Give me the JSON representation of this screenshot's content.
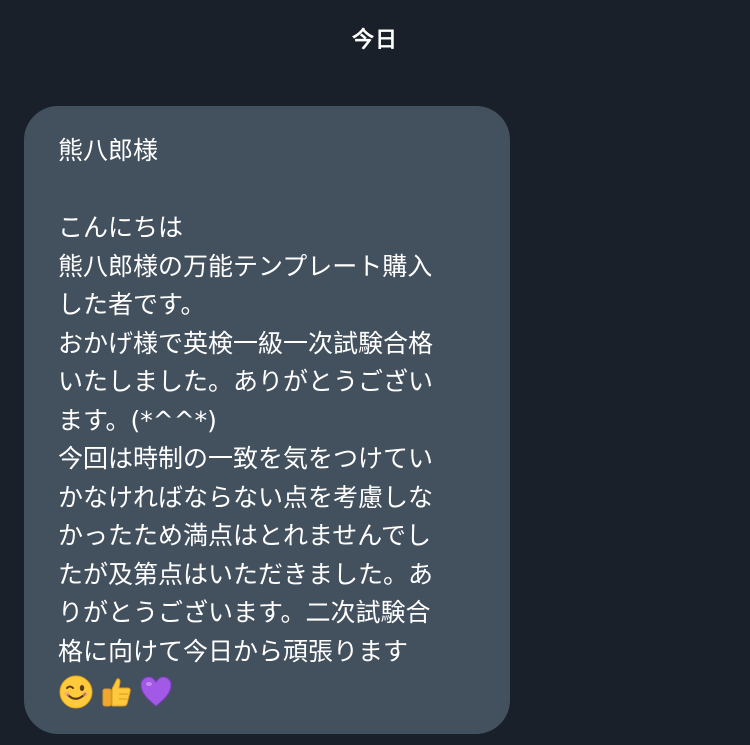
{
  "date_divider": "今日",
  "message": {
    "salutation": "熊八郎様",
    "lines": [
      "こんにちは",
      "熊八郎様の万能テンプレート購入",
      "した者です。",
      "おかげ様で英検一級一次試験合格",
      "いたしました。ありがとうござい",
      "ます。(*^^*)",
      "今回は時制の一致を気をつけてい",
      "かなければならない点を考慮しな",
      "かったため満点はとれませんでし",
      "たが及第点はいただきました。あ",
      "りがとうございます。二次試験合",
      "格に向けて今日から頑張ります"
    ],
    "emojis": [
      "winking-face",
      "thumbs-up",
      "purple-heart"
    ]
  },
  "colors": {
    "background": "#19202a",
    "bubble": "#43505e",
    "text": "#ffffff"
  }
}
